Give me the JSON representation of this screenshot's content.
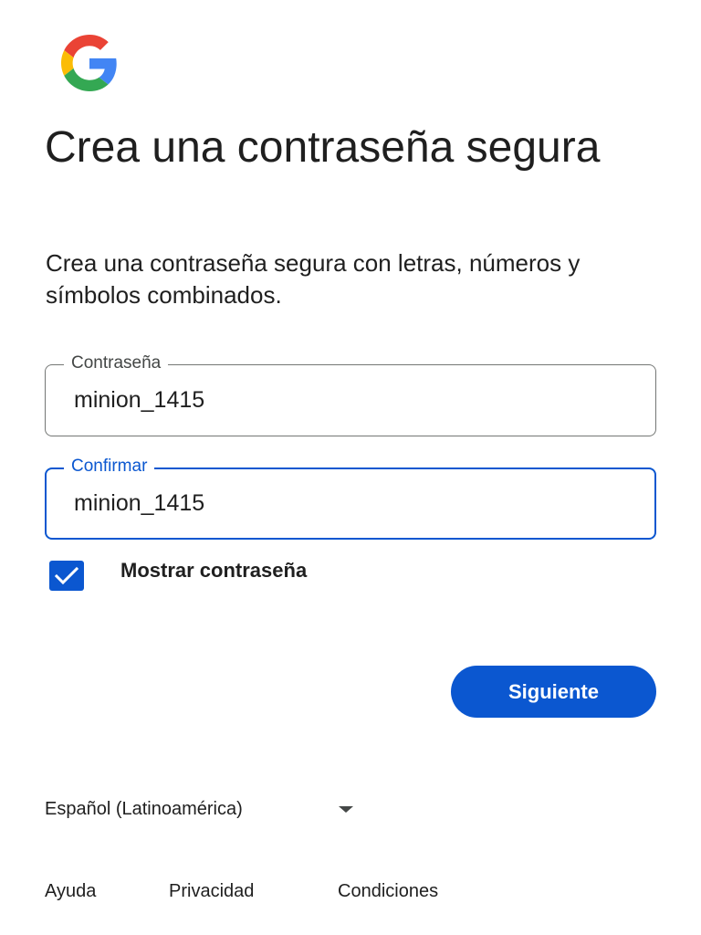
{
  "logo": {
    "icon": "google-g-icon",
    "colors": {
      "blue": "#4285F4",
      "red": "#EA4335",
      "yellow": "#FBBC05",
      "green": "#34A853"
    }
  },
  "header": {
    "title": "Crea una contraseña segura",
    "subtitle": "Crea una contraseña segura con letras, números y símbolos combinados."
  },
  "form": {
    "password": {
      "label": "Contraseña",
      "value": "minion_1415"
    },
    "confirm": {
      "label": "Confirmar",
      "value": "minion_1415",
      "focused": true
    },
    "show_password": {
      "label": "Mostrar contraseña",
      "checked": true,
      "icon": "check-icon"
    }
  },
  "actions": {
    "next_label": "Siguiente"
  },
  "footer": {
    "language": {
      "selected": "Español (Latinoamérica)",
      "icon": "arrow-drop-down-icon"
    },
    "links": [
      {
        "label": "Ayuda"
      },
      {
        "label": "Privacidad"
      },
      {
        "label": "Condiciones"
      }
    ]
  },
  "colors": {
    "accent": "#0b57d0",
    "text": "#1f1f1f",
    "border": "#747775"
  }
}
